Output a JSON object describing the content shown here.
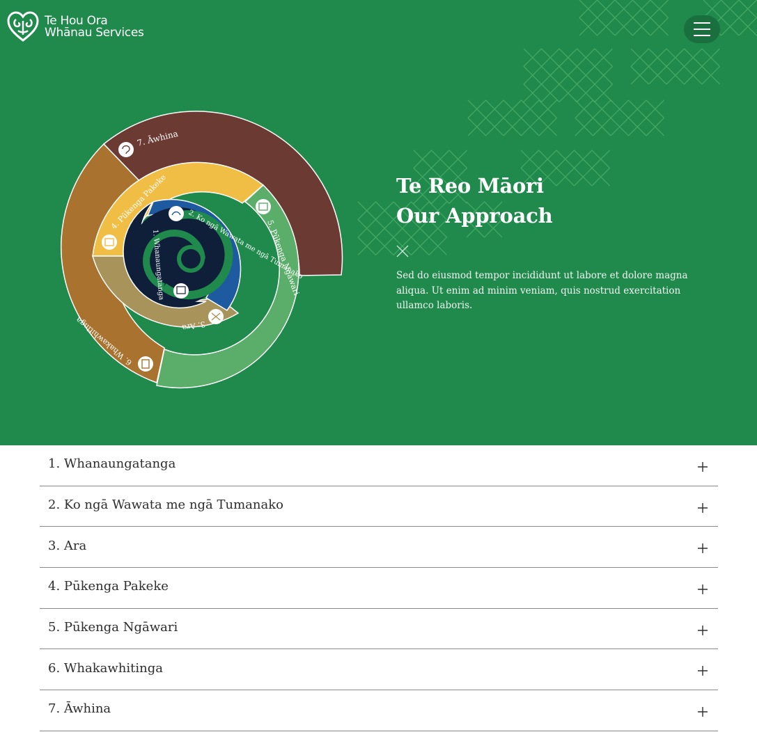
{
  "header": {
    "logo_line1": "Te Hou Ora",
    "logo_line2": "Whānau Services",
    "menu_icon": "hamburger-icon"
  },
  "hero": {
    "title": "Te Reo Māori",
    "subtitle": "Our Approach",
    "body": "Sed do eiusmod tempor incididunt ut labore et dolore magna aliqua. Ut enim ad minim veniam, quis nostrud exercitation ullamco laboris.",
    "colors": {
      "background": "#1f8a4c",
      "pattern": "#4fb06d"
    }
  },
  "spiral": {
    "segments": [
      {
        "label": "1. Whanaungatanga",
        "color": "#0f1f3a",
        "icon": "people-icon"
      },
      {
        "label": "2. Ko ngā Wawata me ngā Tumanako",
        "color": "#1d5aa0",
        "icon": "hand-icon"
      },
      {
        "label": "3. Ara",
        "color": "#a8935a",
        "icon": "path-icon"
      },
      {
        "label": "4. Pūkenga Pakeke",
        "color": "#f0bd45",
        "icon": "tools-icon"
      },
      {
        "label": "5. Pūkenga Ngāwari",
        "color": "#5aae6a",
        "icon": "book-icon"
      },
      {
        "label": "6. Whakawhitinga",
        "color": "#a9722e",
        "icon": "door-icon"
      },
      {
        "label": "7. Āwhina",
        "color": "#6b3a32",
        "icon": "help-icon"
      }
    ]
  },
  "accordion": {
    "items": [
      {
        "label": "1. Whanaungatanga"
      },
      {
        "label": "2. Ko ngā Wawata me ngā Tumanako"
      },
      {
        "label": "3. Ara"
      },
      {
        "label": "4. Pūkenga Pakeke"
      },
      {
        "label": "5. Pūkenga Ngāwari"
      },
      {
        "label": "6. Whakawhitinga"
      },
      {
        "label": "7. Āwhina"
      }
    ]
  }
}
